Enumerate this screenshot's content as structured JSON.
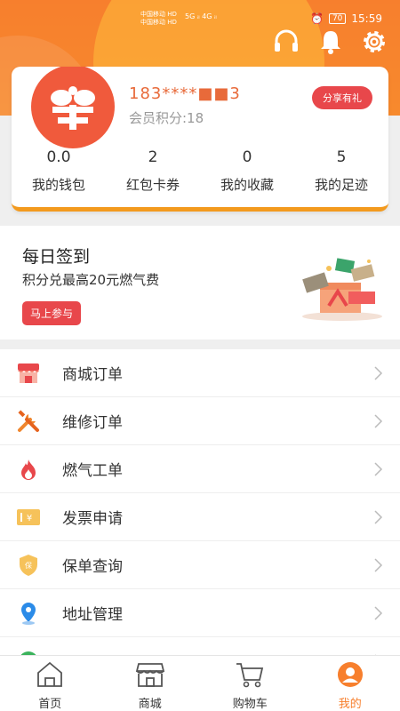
{
  "status_bar": {
    "carrier_line1": "中国移动 HD",
    "carrier_line2": "中国移动 HD",
    "signal": "5G ᵢₗ 4G ᵢₗ",
    "battery": "70",
    "time": "15:59"
  },
  "header_icons": [
    "headset-icon",
    "bell-icon",
    "gear-icon"
  ],
  "user": {
    "phone": "183****■■3",
    "points_label": "会员积分:18",
    "share_button": "分享有礼"
  },
  "stats": [
    {
      "num": "0.0",
      "label": "我的钱包"
    },
    {
      "num": "2",
      "label": "红包卡券"
    },
    {
      "num": "0",
      "label": "我的收藏"
    },
    {
      "num": "5",
      "label": "我的足迹"
    }
  ],
  "signin": {
    "title": "每日签到",
    "subtitle": "积分兑最高20元燃气费",
    "button": "马上参与"
  },
  "menu": [
    {
      "label": "商城订单",
      "icon": "shop-icon"
    },
    {
      "label": "维修订单",
      "icon": "tools-icon"
    },
    {
      "label": "燃气工单",
      "icon": "flame-icon"
    },
    {
      "label": "发票申请",
      "icon": "invoice-icon"
    },
    {
      "label": "保单查询",
      "icon": "shield-icon"
    },
    {
      "label": "地址管理",
      "icon": "location-icon"
    },
    {
      "label": "",
      "icon": "service-icon"
    }
  ],
  "bottom_nav": [
    {
      "label": "首页",
      "icon": "home-icon"
    },
    {
      "label": "商城",
      "icon": "store-icon"
    },
    {
      "label": "购物车",
      "icon": "cart-icon"
    },
    {
      "label": "我的",
      "icon": "profile-icon",
      "active": true
    }
  ],
  "colors": {
    "accent_orange": "#f77f2d",
    "accent_red": "#e8474b",
    "card_underline": "#f39a1e"
  }
}
